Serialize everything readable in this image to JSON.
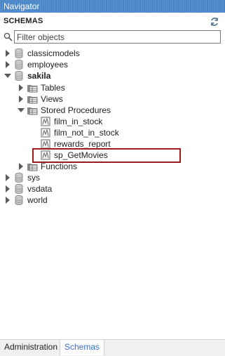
{
  "panel": {
    "title": "Navigator"
  },
  "schemas_header": {
    "title": "SCHEMAS"
  },
  "filter": {
    "placeholder": "Filter objects"
  },
  "tree": {
    "schemas": [
      "classicmodels",
      "employees",
      "sakila",
      "sys",
      "vsdata",
      "world"
    ],
    "sakila_children": [
      "Tables",
      "Views",
      "Stored Procedures",
      "Functions"
    ],
    "procedures": [
      "film_in_stock",
      "film_not_in_stock",
      "rewards_report",
      "sp_GetMovies"
    ]
  },
  "tabs": {
    "administration": "Administration",
    "schemas": "Schemas"
  },
  "colors": {
    "titlebar": "#4a86c8",
    "highlight": "#a01c1c",
    "active_tab_text": "#3a6fc4"
  }
}
